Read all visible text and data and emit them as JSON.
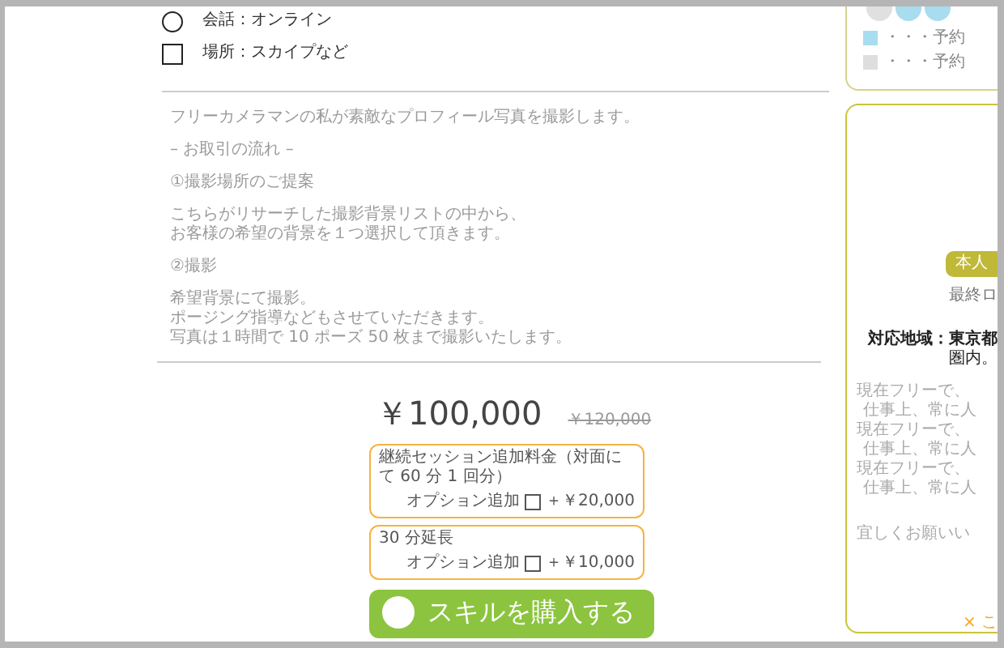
{
  "checklist": [
    {
      "kind": "circle",
      "label": "会話：オンライン"
    },
    {
      "kind": "square",
      "label": "場所：スカイプなど"
    }
  ],
  "description": [
    [
      "フリーカメラマンの私が素敵なプロフィール写真を撮影します。"
    ],
    [
      "– お取引の流れ –"
    ],
    [
      "①撮影場所のご提案"
    ],
    [
      "こちらがリサーチした撮影背景リストの中から、",
      "お客様の希望の背景を１つ選択して頂きます。"
    ],
    [
      "②撮影"
    ],
    [
      "希望背景にて撮影。",
      "ポージング指導などもさせていただきます。",
      "写真は１時間で 10 ポーズ 50 枚まで撮影いたします。"
    ]
  ],
  "price": {
    "current": "￥100,000",
    "original": "￥120,000"
  },
  "options": [
    {
      "title": "継続セッション追加料金（対面にて 60 分 1 回分）",
      "add_label": "オプション追加",
      "checked": false,
      "price": "＋￥20,000"
    },
    {
      "title": "30 分延長",
      "add_label": "オプション追加",
      "checked": false,
      "price": "＋￥10,000"
    }
  ],
  "purchase_button": "スキルを購入する",
  "sidebar": {
    "legend": [
      {
        "color": "#a8dcef",
        "label": "・・・予約"
      },
      {
        "color": "#dedede",
        "label": "・・・予約"
      }
    ],
    "profile_button": "本人",
    "last_login": "最終ロ",
    "area": [
      "対応地域：東京都",
      "圏内。"
    ],
    "bio": [
      "現在フリーで、",
      "仕事上、常に人",
      "現在フリーで、",
      "仕事上、常に人",
      "現在フリーで、",
      "仕事上、常に人"
    ],
    "closing": "宜しくお願いい",
    "close_link": "× こ"
  }
}
